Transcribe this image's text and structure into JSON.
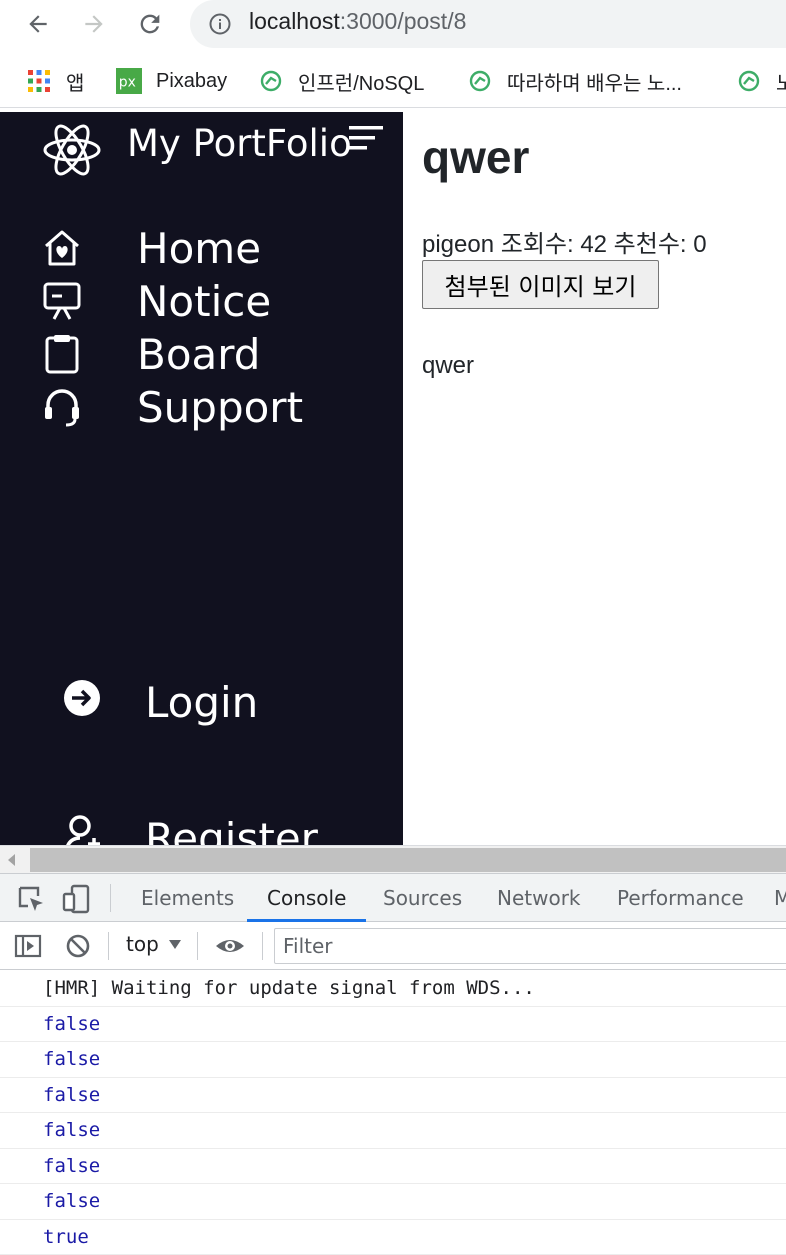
{
  "browser": {
    "url_host": "localhost",
    "url_path": ":3000/post/8",
    "bookmarks": [
      {
        "label": "앱",
        "icon": "apps-grid-icon"
      },
      {
        "label": "Pixabay",
        "icon": "pixabay-icon"
      },
      {
        "label": "인프런/NoSQL",
        "icon": "inflearn-icon"
      },
      {
        "label": "따라하며 배우는 노...",
        "icon": "inflearn-icon"
      },
      {
        "label": "노",
        "icon": "inflearn-icon"
      }
    ]
  },
  "sidebar": {
    "brand": "My PortFolio",
    "items": [
      {
        "label": "Home",
        "icon": "home-heart-icon"
      },
      {
        "label": "Notice",
        "icon": "presentation-board-icon"
      },
      {
        "label": "Board",
        "icon": "clipboard-icon"
      },
      {
        "label": "Support",
        "icon": "headset-icon"
      }
    ],
    "login": "Login",
    "register": "Register"
  },
  "post": {
    "title": "qwer",
    "meta": "pigeon 조회수: 42 추천수: 0",
    "attach_button": "첨부된 이미지 보기",
    "body": "qwer"
  },
  "devtools": {
    "tabs": [
      "Elements",
      "Console",
      "Sources",
      "Network",
      "Performance",
      "M"
    ],
    "active_tab": "Console",
    "context": "top",
    "filter_placeholder": "Filter",
    "logs": [
      "[HMR] Waiting for update signal from WDS...",
      "false",
      "false",
      "false",
      "false",
      "false",
      "false",
      "true"
    ],
    "colors": {
      "accent": "#1a73e8",
      "boolean": "#1a1aa6",
      "sidebar_bg": "#11111f"
    }
  }
}
